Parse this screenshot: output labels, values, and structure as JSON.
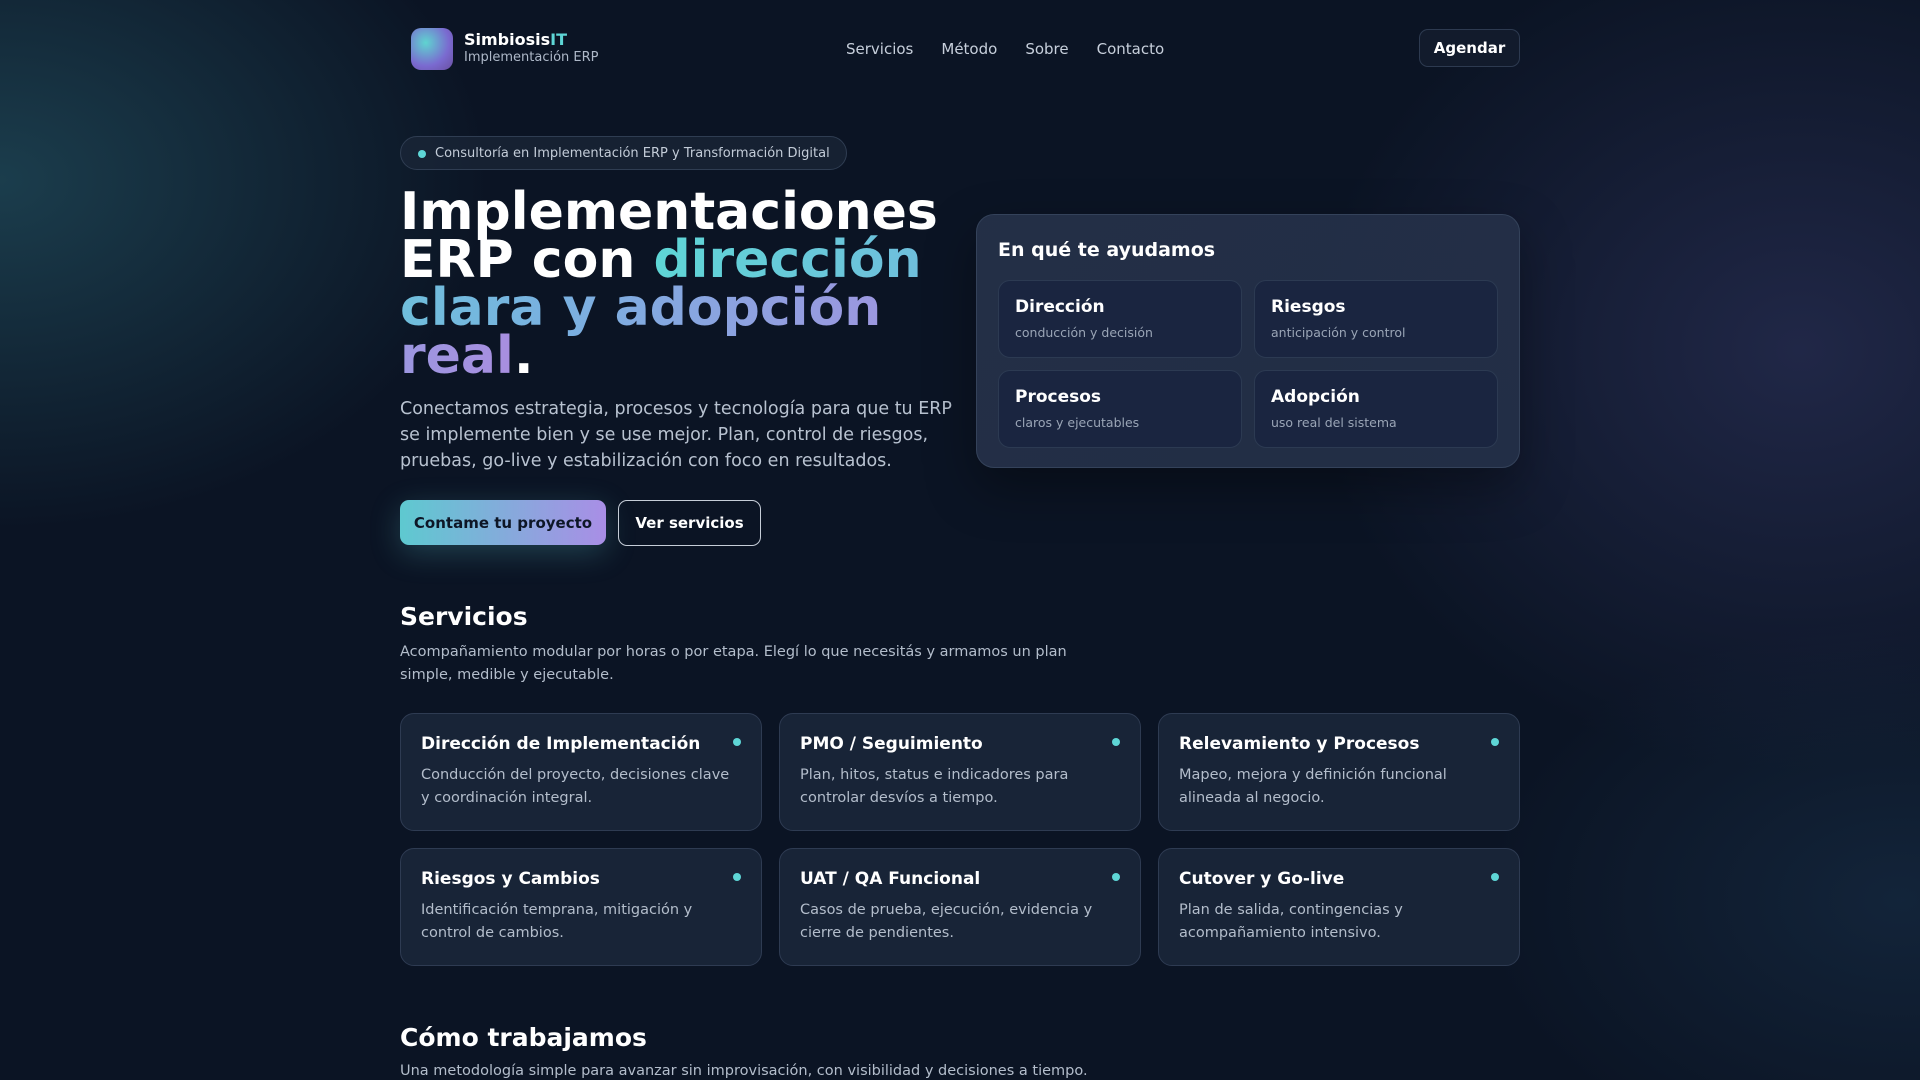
{
  "nav": {
    "brand_main": "Simbiosis",
    "brand_accent": "IT",
    "subtitle": "Implementación ERP",
    "links": [
      "Servicios",
      "Método",
      "Sobre",
      "Contacto"
    ],
    "cta": "Agendar"
  },
  "hero": {
    "badge": "Consultoría en Implementación ERP y Transformación Digital",
    "title_plain": "Implementaciones ERP con ",
    "title_grad": "dirección clara y adopción real",
    "title_end": ".",
    "lead": "Conectamos estrategia, procesos y tecnología para que tu ERP se implemente bien y se use mejor. Plan, control de riesgos, pruebas, go-live y estabilización con foco en resultados.",
    "primary": "Contame tu proyecto",
    "secondary": "Ver servicios"
  },
  "help": {
    "title": "En qué te ayudamos",
    "items": [
      {
        "t": "Dirección",
        "s": "conducción y decisión"
      },
      {
        "t": "Riesgos",
        "s": "anticipación y control"
      },
      {
        "t": "Procesos",
        "s": "claros y ejecutables"
      },
      {
        "t": "Adopción",
        "s": "uso real del sistema"
      }
    ]
  },
  "services": {
    "title": "Servicios",
    "sub": "Acompañamiento modular por horas o por etapa. Elegí lo que necesitás y armamos un plan simple, medible y ejecutable.",
    "cards": [
      {
        "t": "Dirección de Implementación",
        "d": "Conducción del proyecto, decisiones clave y coordinación integral."
      },
      {
        "t": "PMO / Seguimiento",
        "d": "Plan, hitos, status e indicadores para controlar desvíos a tiempo."
      },
      {
        "t": "Relevamiento y Procesos",
        "d": "Mapeo, mejora y definición funcional alineada al negocio."
      },
      {
        "t": "Riesgos y Cambios",
        "d": "Identificación temprana, mitigación y control de cambios."
      },
      {
        "t": "UAT / QA Funcional",
        "d": "Casos de prueba, ejecución, evidencia y cierre de pendientes."
      },
      {
        "t": "Cutover y Go-live",
        "d": "Plan de salida, contingencias y acompañamiento intensivo."
      }
    ]
  },
  "method": {
    "title": "Cómo trabajamos",
    "sub": "Una metodología simple para avanzar sin improvisación, con visibilidad y decisiones a tiempo."
  }
}
